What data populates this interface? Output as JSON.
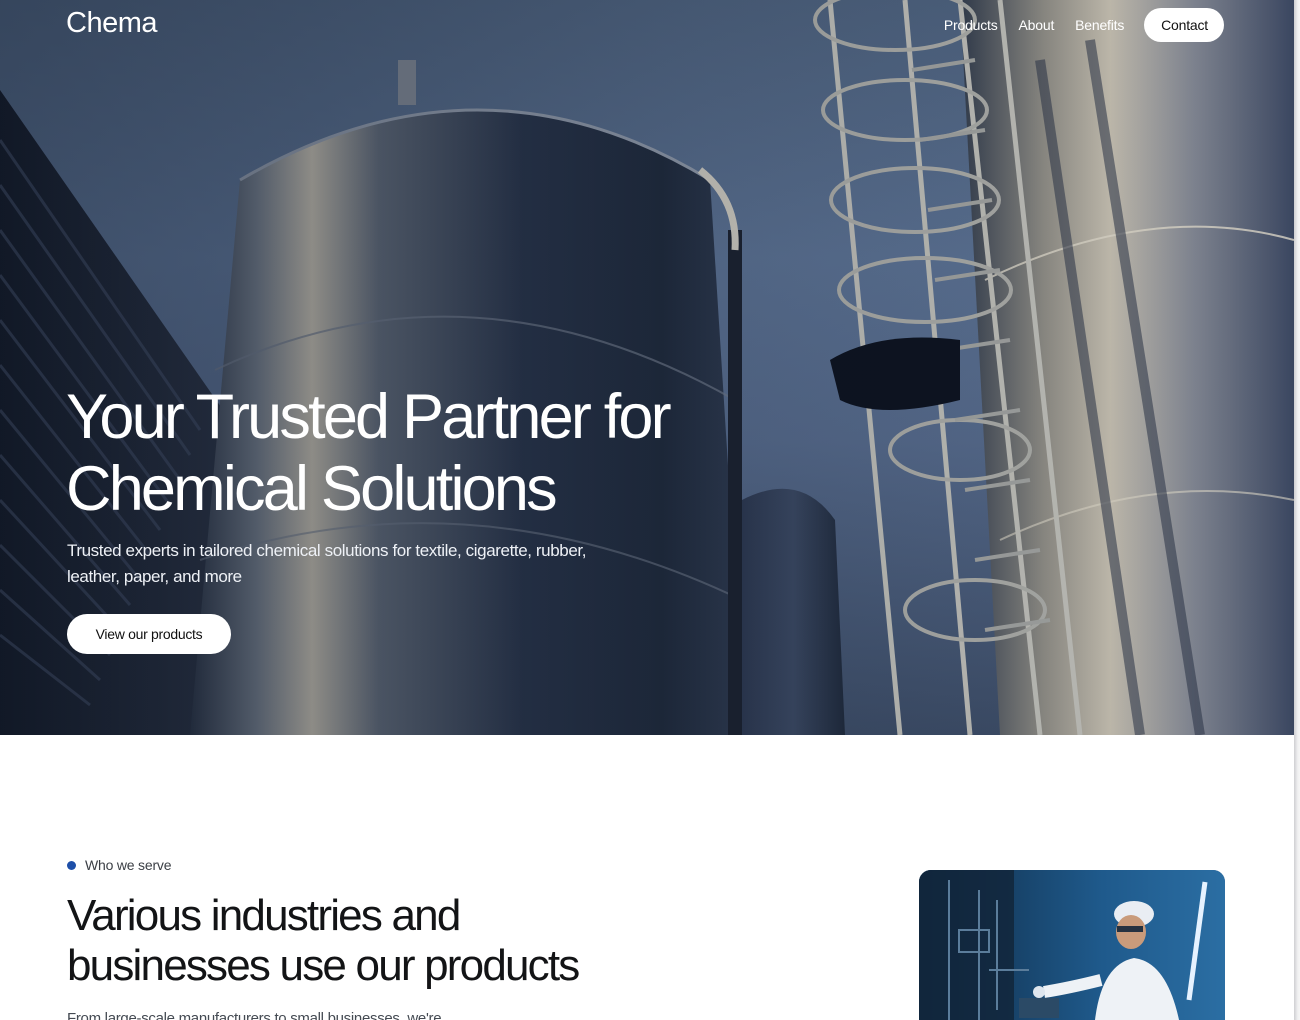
{
  "brand": {
    "name": "Chema"
  },
  "nav": {
    "items": [
      {
        "label": "Products"
      },
      {
        "label": "About"
      },
      {
        "label": "Benefits"
      }
    ],
    "contact_label": "Contact"
  },
  "hero": {
    "title_line1": "Your Trusted Partner for",
    "title_line2": "Chemical Solutions",
    "subtitle": "Trusted experts in tailored chemical solutions for textile, cigarette, rubber, leather, paper, and more",
    "cta_label": "View our products"
  },
  "who_we_serve": {
    "eyebrow": "Who we serve",
    "title_line1": "Various industries and",
    "title_line2": "businesses use our products",
    "body": "From large-scale manufacturers to small businesses, we're"
  },
  "colors": {
    "accent_dot": "#1e4fa8",
    "text_dark": "#131416",
    "hero_sky": "#55698a"
  }
}
